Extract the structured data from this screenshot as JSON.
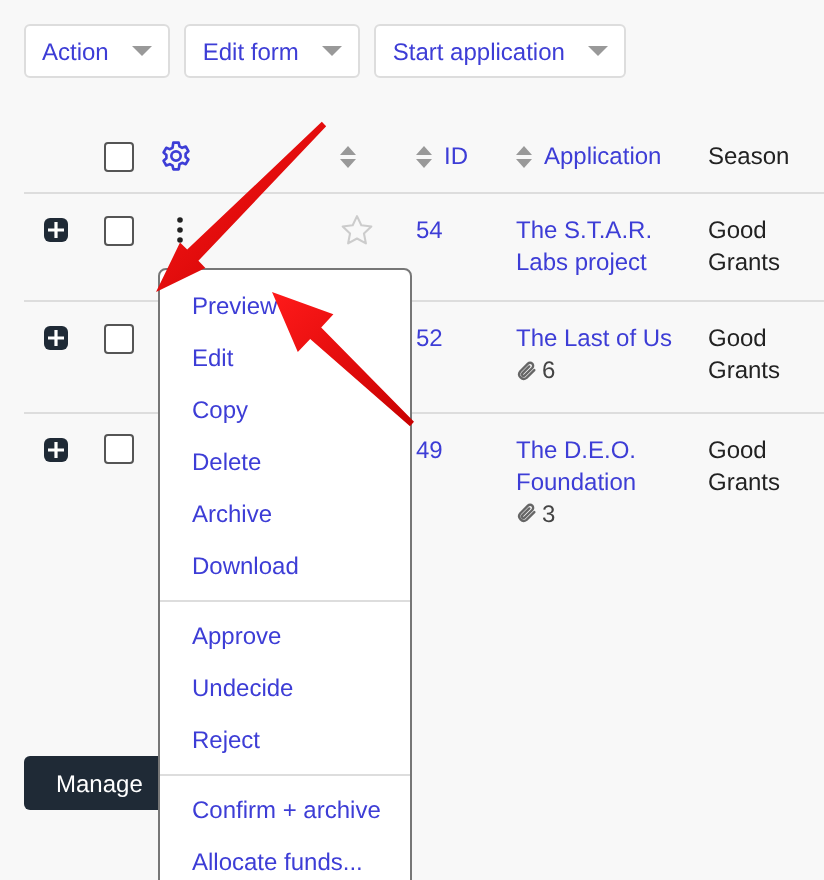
{
  "toolbar": [
    {
      "label": "Action"
    },
    {
      "label": "Edit form"
    },
    {
      "label": "Start application"
    }
  ],
  "table": {
    "select_all": false,
    "columns": [
      {
        "label": "ID",
        "sortable": true
      },
      {
        "label": "Application",
        "sortable": true
      },
      {
        "label": "Season",
        "sortable": false
      }
    ],
    "rows": [
      {
        "id": "54",
        "application": "The S.T.A.R. Labs project",
        "season": "Good Grants",
        "selected": false,
        "starred": false
      },
      {
        "id": "52",
        "application": "The Last of Us",
        "attachments": "6",
        "season": "Good Grants",
        "selected": false
      },
      {
        "id": "49",
        "application": "The D.E.O. Foundation",
        "attachments": "3",
        "season": "Good Grants",
        "selected": false
      }
    ]
  },
  "row_menu": {
    "groups": [
      [
        "Preview",
        "Edit",
        "Copy",
        "Delete",
        "Archive",
        "Download"
      ],
      [
        "Approve",
        "Undecide",
        "Reject"
      ],
      [
        "Confirm + archive",
        "Allocate funds..."
      ]
    ]
  },
  "footer_button": "Manage"
}
